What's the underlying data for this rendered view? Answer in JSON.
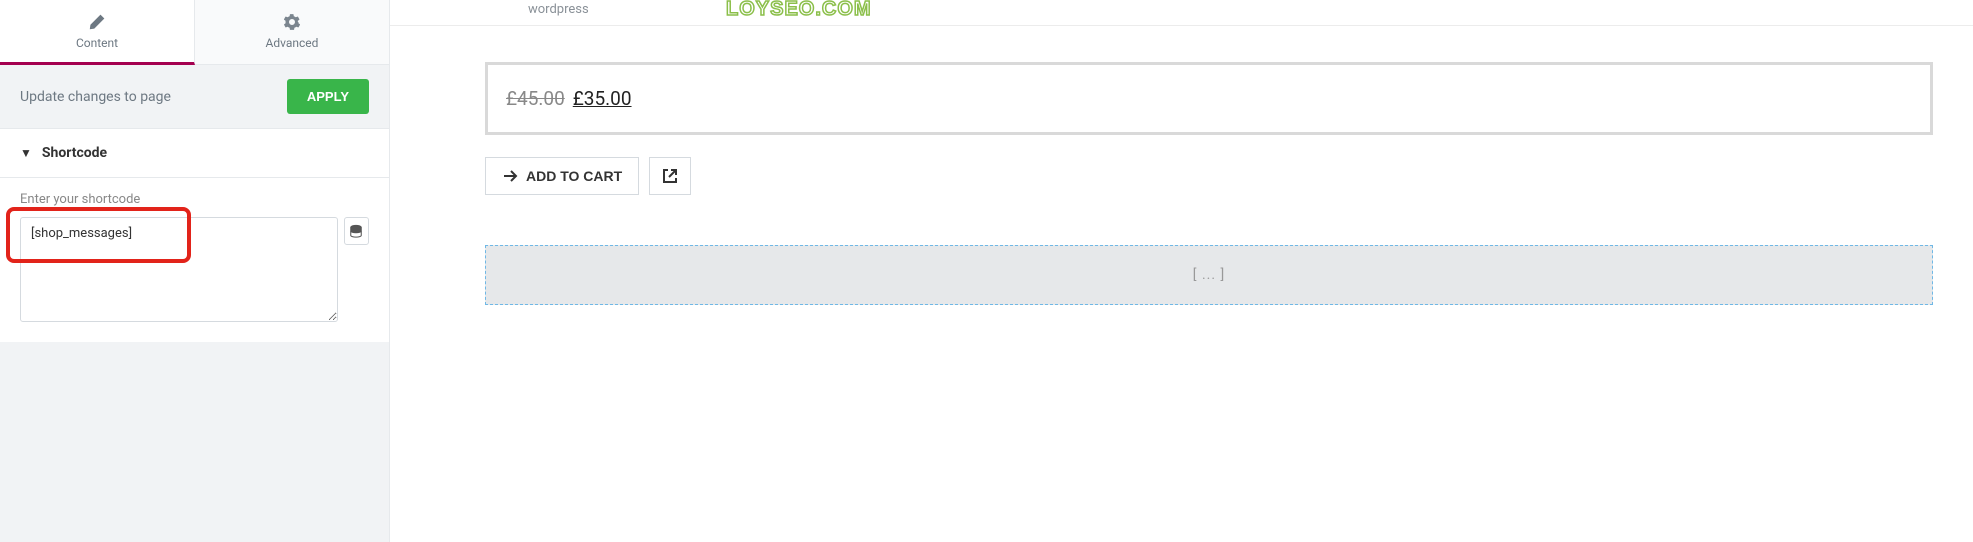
{
  "sidebar": {
    "tabs": {
      "content": {
        "label": "Content",
        "icon": "pencil"
      },
      "advanced": {
        "label": "Advanced",
        "icon": "gear"
      }
    },
    "update": {
      "text": "Update changes to page",
      "button": "APPLY"
    },
    "section": {
      "title": "Shortcode",
      "field_label": "Enter your shortcode",
      "shortcode_value": "[shop_messages]"
    }
  },
  "preview": {
    "top_text": "wordpress",
    "watermark": "LOYSEO.COM",
    "price_old": "£45.00",
    "price_new": "£35.00",
    "add_to_cart": "ADD TO CART",
    "placeholder": "[ ... ]"
  }
}
